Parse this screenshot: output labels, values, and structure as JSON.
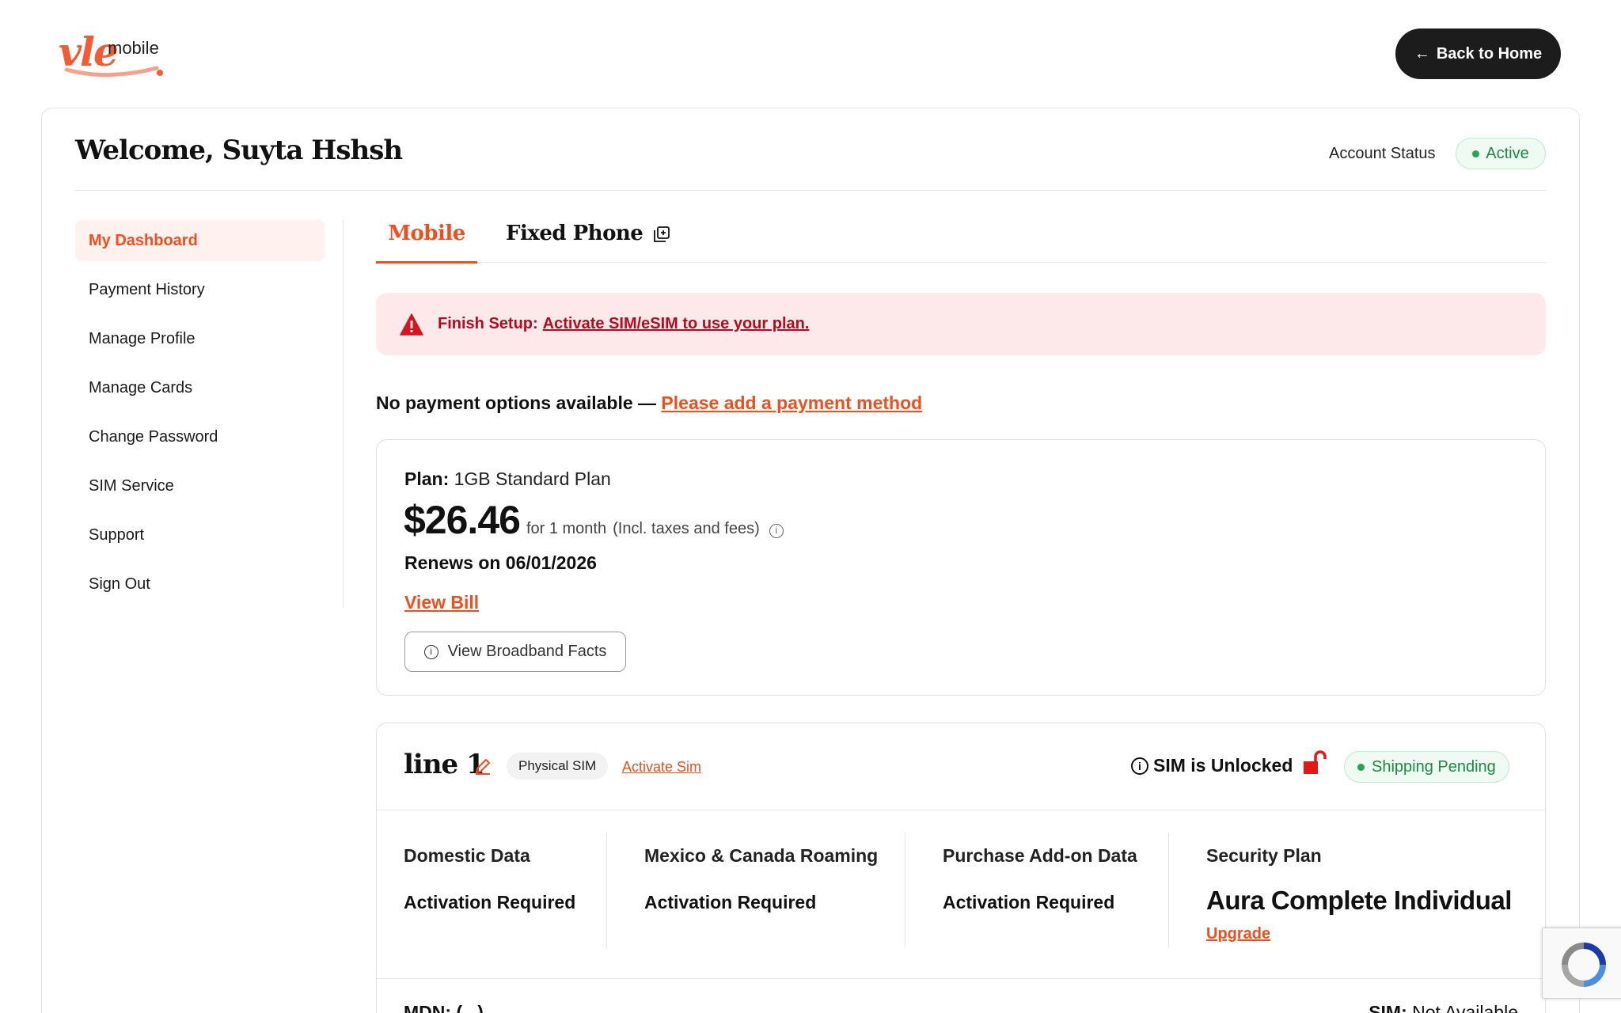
{
  "brand": {
    "logo_mark": "vle",
    "logo_word": "mobile",
    "accent": "#ef4e1d",
    "success": "#1b8a45",
    "danger": "#b30d1d"
  },
  "header": {
    "back_label": "Back to Home",
    "back_icon": "arrow-left-icon"
  },
  "account": {
    "welcome": "Welcome, Suyta Hshsh",
    "status_label": "Account Status",
    "status_value": "Active"
  },
  "sidebar": {
    "items": [
      {
        "label": "My Dashboard",
        "active": true
      },
      {
        "label": "Payment History"
      },
      {
        "label": "Manage Profile"
      },
      {
        "label": "Manage Cards"
      },
      {
        "label": "Change Password"
      },
      {
        "label": "SIM Service"
      },
      {
        "label": "Support"
      },
      {
        "label": "Sign Out"
      }
    ]
  },
  "tabs": {
    "mobile": "Mobile",
    "fixed": "Fixed Phone",
    "fixed_icon": "external-link-icon"
  },
  "alert": {
    "prefix": "Finish Setup:",
    "link": "Activate SIM/eSIM to use your plan.",
    "icon": "warning-icon"
  },
  "payment": {
    "notice": "No payment options available —",
    "link": "Please add a payment method"
  },
  "plan": {
    "label": "Plan:",
    "name": "1GB Standard Plan",
    "price": "$26.46",
    "period": "for 1 month",
    "taxes": "(Incl. taxes and fees)",
    "renews": "Renews on 06/01/2026",
    "view_bill": "View Bill",
    "broadband": "View Broadband Facts"
  },
  "line": {
    "title": "line 1",
    "sim_type": "Physical SIM",
    "activate": "Activate Sim",
    "unlocked": "SIM is Unlocked",
    "shipping": "Shipping Pending",
    "features": [
      {
        "title": "Domestic Data",
        "value": "Activation Required"
      },
      {
        "title": "Mexico & Canada Roaming",
        "value": "Activation Required"
      },
      {
        "title": "Purchase Add-on Data",
        "value": "Activation Required"
      },
      {
        "title": "Security Plan",
        "value": "Aura Complete Individual",
        "action": "Upgrade"
      }
    ],
    "mdn": "MDN: (...)",
    "sim_label": "SIM:",
    "sim_value": "Not Available"
  }
}
